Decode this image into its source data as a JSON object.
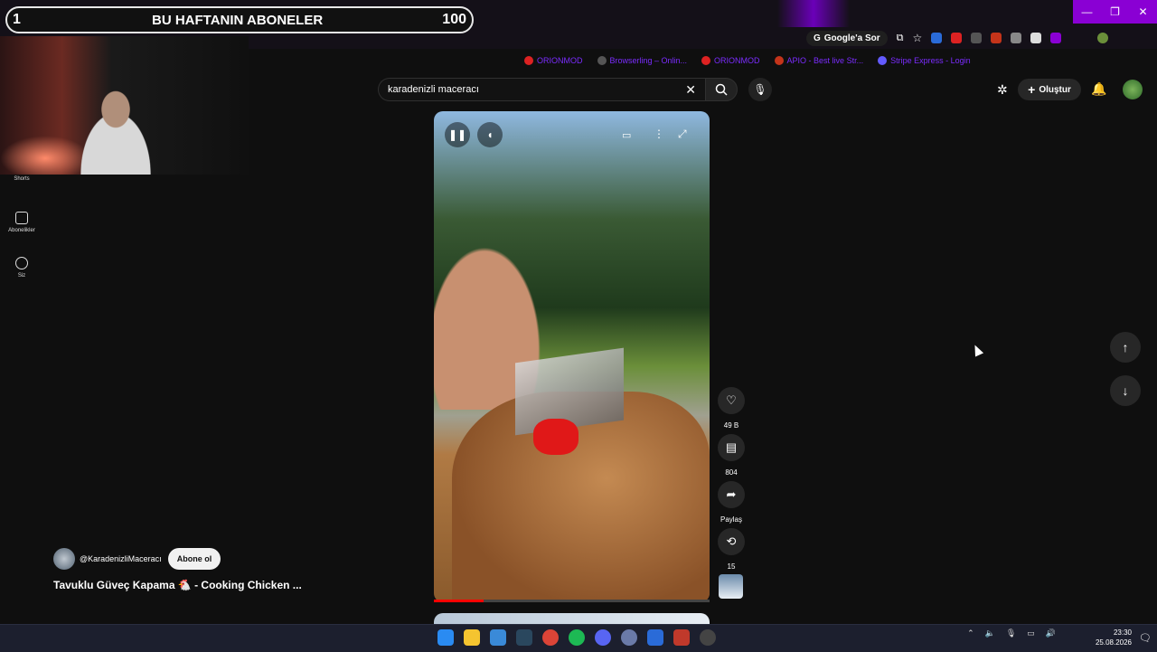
{
  "overlay": {
    "rank": "1",
    "title": "BU HAFTANIN ABONELER",
    "count": "100"
  },
  "browser": {
    "google_sor": "Google'a Sor",
    "bookmarks": [
      "ORIONMOD",
      "Browserling – Onlin...",
      "ORIONMOD",
      "APIO - Best live Str...",
      "Stripe Express - Login"
    ],
    "window_controls": [
      "—",
      "❐",
      "✕"
    ]
  },
  "sidebar": {
    "items": [
      {
        "label": "Shorts"
      },
      {
        "label": "Abonelikler"
      },
      {
        "label": "Siz"
      }
    ]
  },
  "search": {
    "query": "karadenizli maceracı"
  },
  "header": {
    "create_label": "Oluştur"
  },
  "actions": {
    "likes": "49 B",
    "comments": "804",
    "share": "Paylaş",
    "remix": "15"
  },
  "channel": {
    "handle": "@KaradenizliMaceracı",
    "subscribe": "Abone ol"
  },
  "video": {
    "title": "Tavuklu Güveç Kapama 🐔 - Cooking Chicken ...",
    "progress": 0.18
  },
  "taskbar": {
    "time": "23:30",
    "date": "25.08.2026"
  },
  "colors": {
    "accent": "#8a00d4",
    "progress": "#ff0000",
    "bookmark_text": "#7b2cff"
  }
}
